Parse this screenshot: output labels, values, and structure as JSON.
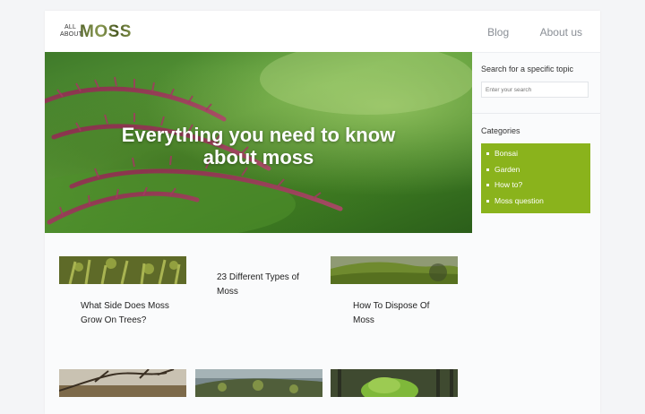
{
  "header": {
    "logo": {
      "line1": "ALL",
      "line2": "ABOUT",
      "brand": "MOSS"
    },
    "nav": [
      {
        "label": "Blog"
      },
      {
        "label": "About us"
      }
    ]
  },
  "hero": {
    "title_line1": "Everything you need to know",
    "title_line2": "about moss"
  },
  "sidebar": {
    "search_label": "Search for a specific topic",
    "search_placeholder": "Enter your search",
    "categories_label": "Categories",
    "categories": [
      {
        "label": "Bonsai"
      },
      {
        "label": "Garden"
      },
      {
        "label": "How to?"
      },
      {
        "label": "Moss question"
      }
    ]
  },
  "posts": [
    {
      "title_line1": "What Side Does Moss",
      "title_line2": "Grow On Trees?"
    },
    {
      "title_line1": "23 Different Types of",
      "title_line2": "Moss"
    },
    {
      "title_line1": "How To Dispose Of",
      "title_line2": "Moss"
    }
  ],
  "colors": {
    "accent": "#8ab31c",
    "nav_text": "#8a8f96",
    "background": "#f4f5f7"
  }
}
